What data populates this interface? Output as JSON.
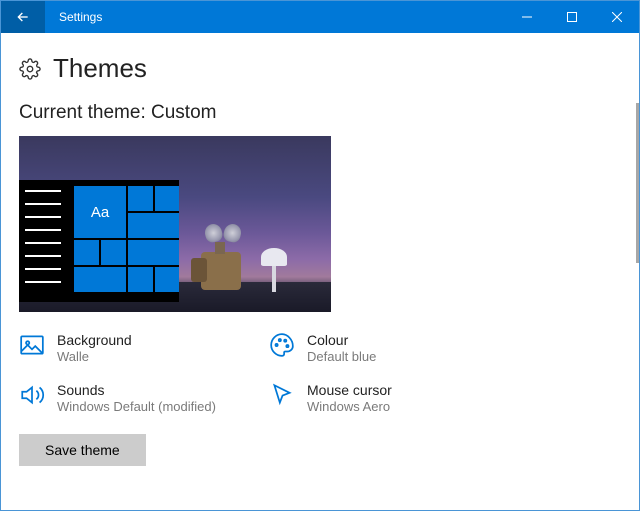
{
  "window": {
    "title": "Settings"
  },
  "page": {
    "heading": "Themes",
    "subheading": "Current theme: Custom"
  },
  "preview": {
    "tile_label": "Aa"
  },
  "options": {
    "background": {
      "label": "Background",
      "value": "Walle"
    },
    "colour": {
      "label": "Colour",
      "value": "Default blue"
    },
    "sounds": {
      "label": "Sounds",
      "value": "Windows Default (modified)"
    },
    "cursor": {
      "label": "Mouse cursor",
      "value": "Windows Aero"
    }
  },
  "buttons": {
    "save_theme": "Save theme"
  },
  "colors": {
    "accent": "#0078d7"
  }
}
